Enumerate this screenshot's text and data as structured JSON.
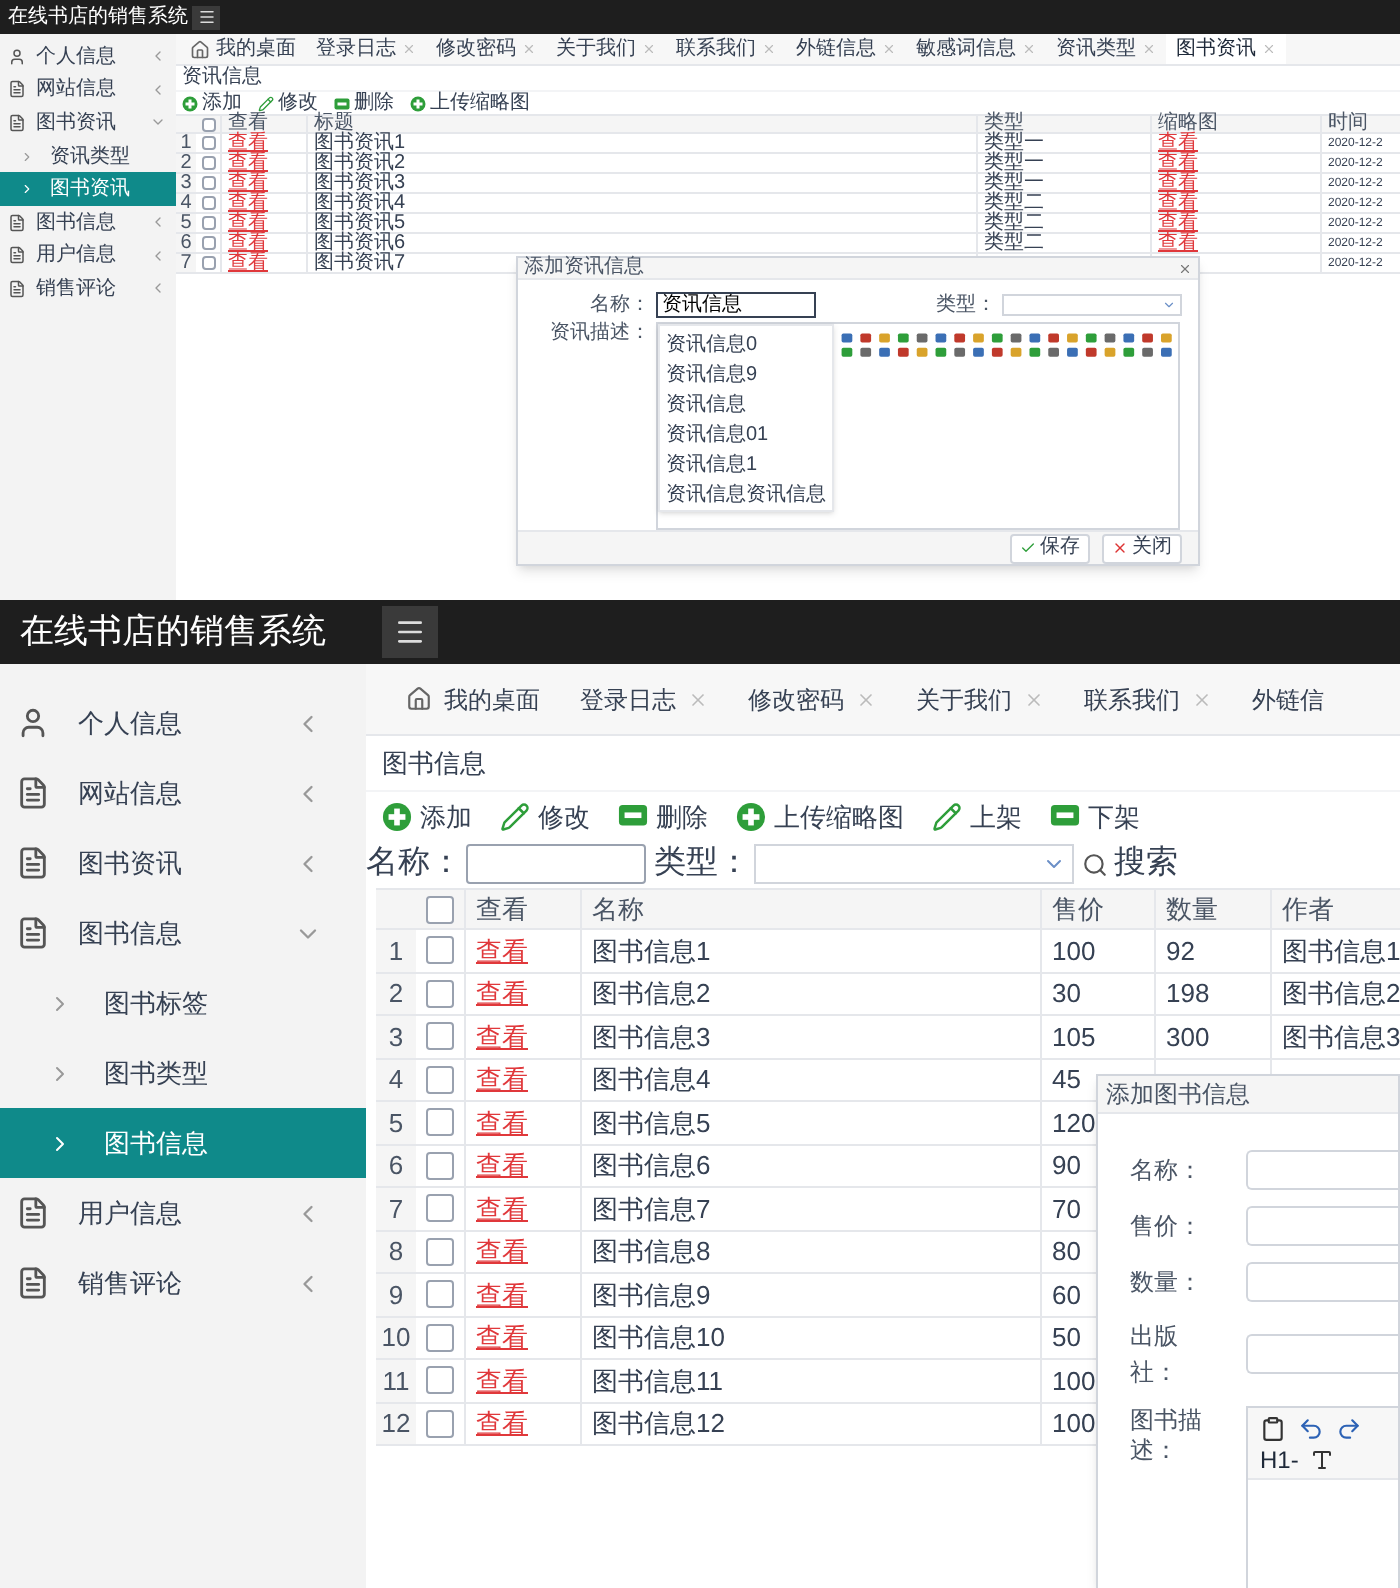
{
  "screens": [
    {
      "app_title": "在线书店的销售系统",
      "sidebar": [
        {
          "label": "个人信息",
          "kind": "user",
          "expanded": false
        },
        {
          "label": "网站信息",
          "kind": "doc",
          "expanded": false
        },
        {
          "label": "图书资讯",
          "kind": "doc",
          "expanded": true,
          "children": [
            {
              "label": "资讯类型",
              "selected": false
            },
            {
              "label": "图书资讯",
              "selected": true
            }
          ]
        },
        {
          "label": "图书信息",
          "kind": "doc",
          "expanded": false
        },
        {
          "label": "用户信息",
          "kind": "doc",
          "expanded": false
        },
        {
          "label": "销售评论",
          "kind": "doc",
          "expanded": false
        }
      ],
      "tabs": [
        {
          "label": "我的桌面",
          "kind": "home",
          "selected": false
        },
        {
          "label": "登录日志",
          "kind": "closable",
          "selected": false
        },
        {
          "label": "修改密码",
          "kind": "closable",
          "selected": false
        },
        {
          "label": "关于我们",
          "kind": "closable",
          "selected": false
        },
        {
          "label": "联系我们",
          "kind": "closable",
          "selected": false
        },
        {
          "label": "外链信息",
          "kind": "closable",
          "selected": false
        },
        {
          "label": "敏感词信息",
          "kind": "closable",
          "selected": false
        },
        {
          "label": "资讯类型",
          "kind": "closable",
          "selected": false
        },
        {
          "label": "图书资讯",
          "kind": "closable",
          "selected": true
        }
      ],
      "page_title": "资讯信息",
      "toolbar": [
        {
          "label": "添加",
          "kind": "add"
        },
        {
          "label": "修改",
          "kind": "edit"
        },
        {
          "label": "删除",
          "kind": "remove"
        },
        {
          "label": "上传缩略图",
          "kind": "add"
        }
      ],
      "table": {
        "header_checked": false,
        "columns": [
          {
            "label": "查看",
            "kind": "link"
          },
          {
            "label": "标题",
            "kind": "text"
          },
          {
            "label": "类型",
            "kind": "text"
          },
          {
            "label": "缩略图",
            "kind": "link"
          },
          {
            "label": "时间",
            "kind": "date"
          }
        ],
        "rows": [
          {
            "no": "1",
            "checked": false,
            "cells": [
              "查看",
              "图书资讯1",
              "类型一",
              "查看",
              "2020-12-2"
            ]
          },
          {
            "no": "2",
            "checked": false,
            "cells": [
              "查看",
              "图书资讯2",
              "类型一",
              "查看",
              "2020-12-2"
            ]
          },
          {
            "no": "3",
            "checked": false,
            "cells": [
              "查看",
              "图书资讯3",
              "类型一",
              "查看",
              "2020-12-2"
            ]
          },
          {
            "no": "4",
            "checked": false,
            "cells": [
              "查看",
              "图书资讯4",
              "类型二",
              "查看",
              "2020-12-2"
            ]
          },
          {
            "no": "5",
            "checked": false,
            "cells": [
              "查看",
              "图书资讯5",
              "类型二",
              "查看",
              "2020-12-2"
            ]
          },
          {
            "no": "6",
            "checked": false,
            "cells": [
              "查看",
              "图书资讯6",
              "类型二",
              "查看",
              "2020-12-2"
            ]
          },
          {
            "no": "7",
            "checked": false,
            "cells": [
              "查看",
              "图书资讯7",
              null,
              null,
              "2020-12-2"
            ]
          }
        ]
      },
      "dialog": {
        "title": "添加资讯信息",
        "fields": [
          {
            "label": "名称：",
            "kind": "text",
            "value": "资讯信息",
            "focused": true
          },
          {
            "label": "类型：",
            "kind": "select"
          },
          {
            "label": "资讯描述：",
            "kind": "editor"
          }
        ],
        "suggestions": [
          "资讯信息0",
          "资讯信息9",
          "资讯信息",
          "资讯信息01",
          "资讯信息1",
          "资讯信息资讯信息"
        ],
        "buttons": [
          {
            "label": "保存",
            "kind": "check"
          },
          {
            "label": "关闭",
            "kind": "close"
          }
        ]
      }
    },
    {
      "app_title": "在线书店的销售系统",
      "sidebar": [
        {
          "label": "个人信息",
          "kind": "user",
          "expanded": false
        },
        {
          "label": "网站信息",
          "kind": "doc",
          "expanded": false
        },
        {
          "label": "图书资讯",
          "kind": "doc",
          "expanded": false
        },
        {
          "label": "图书信息",
          "kind": "doc",
          "expanded": true,
          "children": [
            {
              "label": "图书标签",
              "selected": false
            },
            {
              "label": "图书类型",
              "selected": false
            },
            {
              "label": "图书信息",
              "selected": true
            }
          ]
        },
        {
          "label": "用户信息",
          "kind": "doc",
          "expanded": false
        },
        {
          "label": "销售评论",
          "kind": "doc",
          "expanded": false
        }
      ],
      "tabs": [
        {
          "label": "我的桌面",
          "kind": "home",
          "selected": false
        },
        {
          "label": "登录日志",
          "kind": "closable",
          "selected": false
        },
        {
          "label": "修改密码",
          "kind": "closable",
          "selected": false
        },
        {
          "label": "关于我们",
          "kind": "closable",
          "selected": false
        },
        {
          "label": "联系我们",
          "kind": "closable",
          "selected": false
        },
        {
          "label": "外链信",
          "kind": "plain",
          "selected": false
        }
      ],
      "page_title": "图书信息",
      "toolbar": [
        {
          "label": "添加",
          "kind": "add"
        },
        {
          "label": "修改",
          "kind": "edit"
        },
        {
          "label": "删除",
          "kind": "remove"
        },
        {
          "label": "上传缩略图",
          "kind": "add"
        },
        {
          "label": "上架",
          "kind": "edit"
        },
        {
          "label": "下架",
          "kind": "remove"
        }
      ],
      "search": {
        "fields": [
          {
            "label": "名称：",
            "kind": "text"
          },
          {
            "label": "类型：",
            "kind": "select"
          }
        ],
        "button": "搜索"
      },
      "table": {
        "header_checked": false,
        "columns": [
          {
            "label": "查看",
            "kind": "link"
          },
          {
            "label": "名称",
            "kind": "text"
          },
          {
            "label": "售价",
            "kind": "text"
          },
          {
            "label": "数量",
            "kind": "text"
          },
          {
            "label": "作者",
            "kind": "text"
          }
        ],
        "rows": [
          {
            "no": "1",
            "checked": false,
            "cells": [
              "查看",
              "图书信息1",
              "100",
              "92",
              "图书信息1"
            ]
          },
          {
            "no": "2",
            "checked": false,
            "cells": [
              "查看",
              "图书信息2",
              "30",
              "198",
              "图书信息2"
            ]
          },
          {
            "no": "3",
            "checked": false,
            "cells": [
              "查看",
              "图书信息3",
              "105",
              "300",
              "图书信息3"
            ]
          },
          {
            "no": "4",
            "checked": false,
            "cells": [
              "查看",
              "图书信息4",
              "45"
            ]
          },
          {
            "no": "5",
            "checked": false,
            "cells": [
              "查看",
              "图书信息5",
              "120"
            ]
          },
          {
            "no": "6",
            "checked": false,
            "cells": [
              "查看",
              "图书信息6",
              "90"
            ]
          },
          {
            "no": "7",
            "checked": false,
            "cells": [
              "查看",
              "图书信息7",
              "70"
            ]
          },
          {
            "no": "8",
            "checked": false,
            "cells": [
              "查看",
              "图书信息8",
              "80"
            ]
          },
          {
            "no": "9",
            "checked": false,
            "cells": [
              "查看",
              "图书信息9",
              "60"
            ]
          },
          {
            "no": "10",
            "checked": false,
            "cells": [
              "查看",
              "图书信息10",
              "50"
            ]
          },
          {
            "no": "11",
            "checked": false,
            "cells": [
              "查看",
              "图书信息11",
              "100"
            ]
          },
          {
            "no": "12",
            "checked": false,
            "cells": [
              "查看",
              "图书信息12",
              "100"
            ]
          }
        ]
      },
      "dialog": {
        "title": "添加图书信息",
        "fields": [
          {
            "label": "名称：",
            "kind": "text",
            "focused": false
          },
          {
            "label": "售价：",
            "kind": "text",
            "focused": false
          },
          {
            "label": "数量：",
            "kind": "text",
            "focused": false
          },
          {
            "label": "出版社：",
            "kind": "text",
            "focused": false
          },
          {
            "label": "图书描述：",
            "kind": "editor",
            "heading": "H1-"
          }
        ]
      }
    }
  ]
}
